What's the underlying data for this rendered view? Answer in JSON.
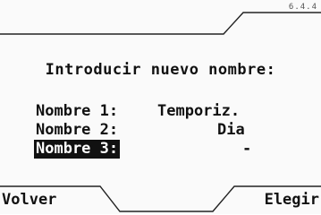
{
  "header": {
    "version": "6.4.4"
  },
  "dialog": {
    "prompt": "Introducir nuevo nombre:",
    "fields": [
      {
        "label": "Nombre 1:",
        "value": "Temporiz.",
        "selected": false
      },
      {
        "label": "Nombre 2:",
        "value": "Dia",
        "selected": false
      },
      {
        "label": "Nombre 3:",
        "value": "-",
        "selected": true
      }
    ]
  },
  "softkeys": {
    "left_label": "Volver",
    "right_label": "Elegir"
  }
}
